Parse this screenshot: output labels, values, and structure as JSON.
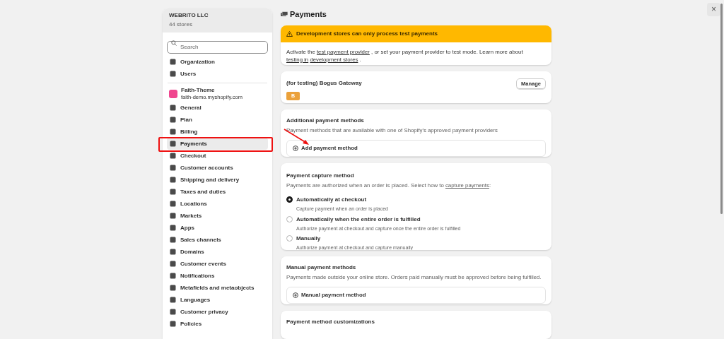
{
  "org": {
    "name": "WEBRITO LLC",
    "stores": "44 stores"
  },
  "search": {
    "placeholder": "Search"
  },
  "org_items": [
    {
      "label": "Organization",
      "selected": false
    },
    {
      "label": "Users",
      "selected": false
    }
  ],
  "store": {
    "name": "Faith-Theme",
    "domain": "faith-demo.myshopify.com"
  },
  "store_items": [
    {
      "label": "General",
      "selected": false
    },
    {
      "label": "Plan",
      "selected": false
    },
    {
      "label": "Billing",
      "selected": false
    },
    {
      "label": "Payments",
      "selected": true
    },
    {
      "label": "Checkout",
      "selected": false
    },
    {
      "label": "Customer accounts",
      "selected": false
    },
    {
      "label": "Shipping and delivery",
      "selected": false
    },
    {
      "label": "Taxes and duties",
      "selected": false
    },
    {
      "label": "Locations",
      "selected": false
    },
    {
      "label": "Markets",
      "selected": false
    },
    {
      "label": "Apps",
      "selected": false
    },
    {
      "label": "Sales channels",
      "selected": false
    },
    {
      "label": "Domains",
      "selected": false
    },
    {
      "label": "Customer events",
      "selected": false
    },
    {
      "label": "Notifications",
      "selected": false
    },
    {
      "label": "Metafields and metaobjects",
      "selected": false
    },
    {
      "label": "Languages",
      "selected": false
    },
    {
      "label": "Customer privacy",
      "selected": false
    },
    {
      "label": "Policies",
      "selected": false
    }
  ],
  "page_title": "Payments",
  "banner": {
    "title": "Development stores can only process test payments",
    "parts": [
      {
        "kind": "text",
        "text": "Activate the "
      },
      {
        "kind": "link",
        "text": "test payment provider"
      },
      {
        "kind": "text",
        "text": ", or set your payment provider to test mode. Learn more about "
      },
      {
        "kind": "link",
        "text": "testing in"
      },
      {
        "kind": "link",
        "text": "development stores"
      },
      {
        "kind": "text",
        "text": "."
      }
    ]
  },
  "gateway": {
    "name": "(for testing) Bogus Gateway",
    "button": "Manage",
    "logo": "B"
  },
  "additional": {
    "title": "Additional payment methods",
    "subtitle": "Payment methods that are available with one of Shopify's approved payment providers",
    "action": "Add payment method"
  },
  "capture": {
    "title": "Payment capture method",
    "subtitle": "Payments are authorized when an order is placed. Select how to ",
    "link": "capture payments",
    "after": ":",
    "options": [
      {
        "label": "Automatically at checkout",
        "help": "Capture payment when an order is placed",
        "selected": true
      },
      {
        "label": "Automatically when the entire order is fulfilled",
        "help": "Authorize payment at checkout and capture once the entire order is fulfilled",
        "selected": false
      },
      {
        "label": "Manually",
        "help": "Authorize payment at checkout and capture manually",
        "selected": false
      }
    ]
  },
  "manual": {
    "title": "Manual payment methods",
    "subtitle": "Payments made outside your online store. Orders paid manually must be approved before being fulfilled.",
    "action": "Manual payment method"
  },
  "customizations": {
    "title": "Payment method customizations"
  },
  "close": "×"
}
